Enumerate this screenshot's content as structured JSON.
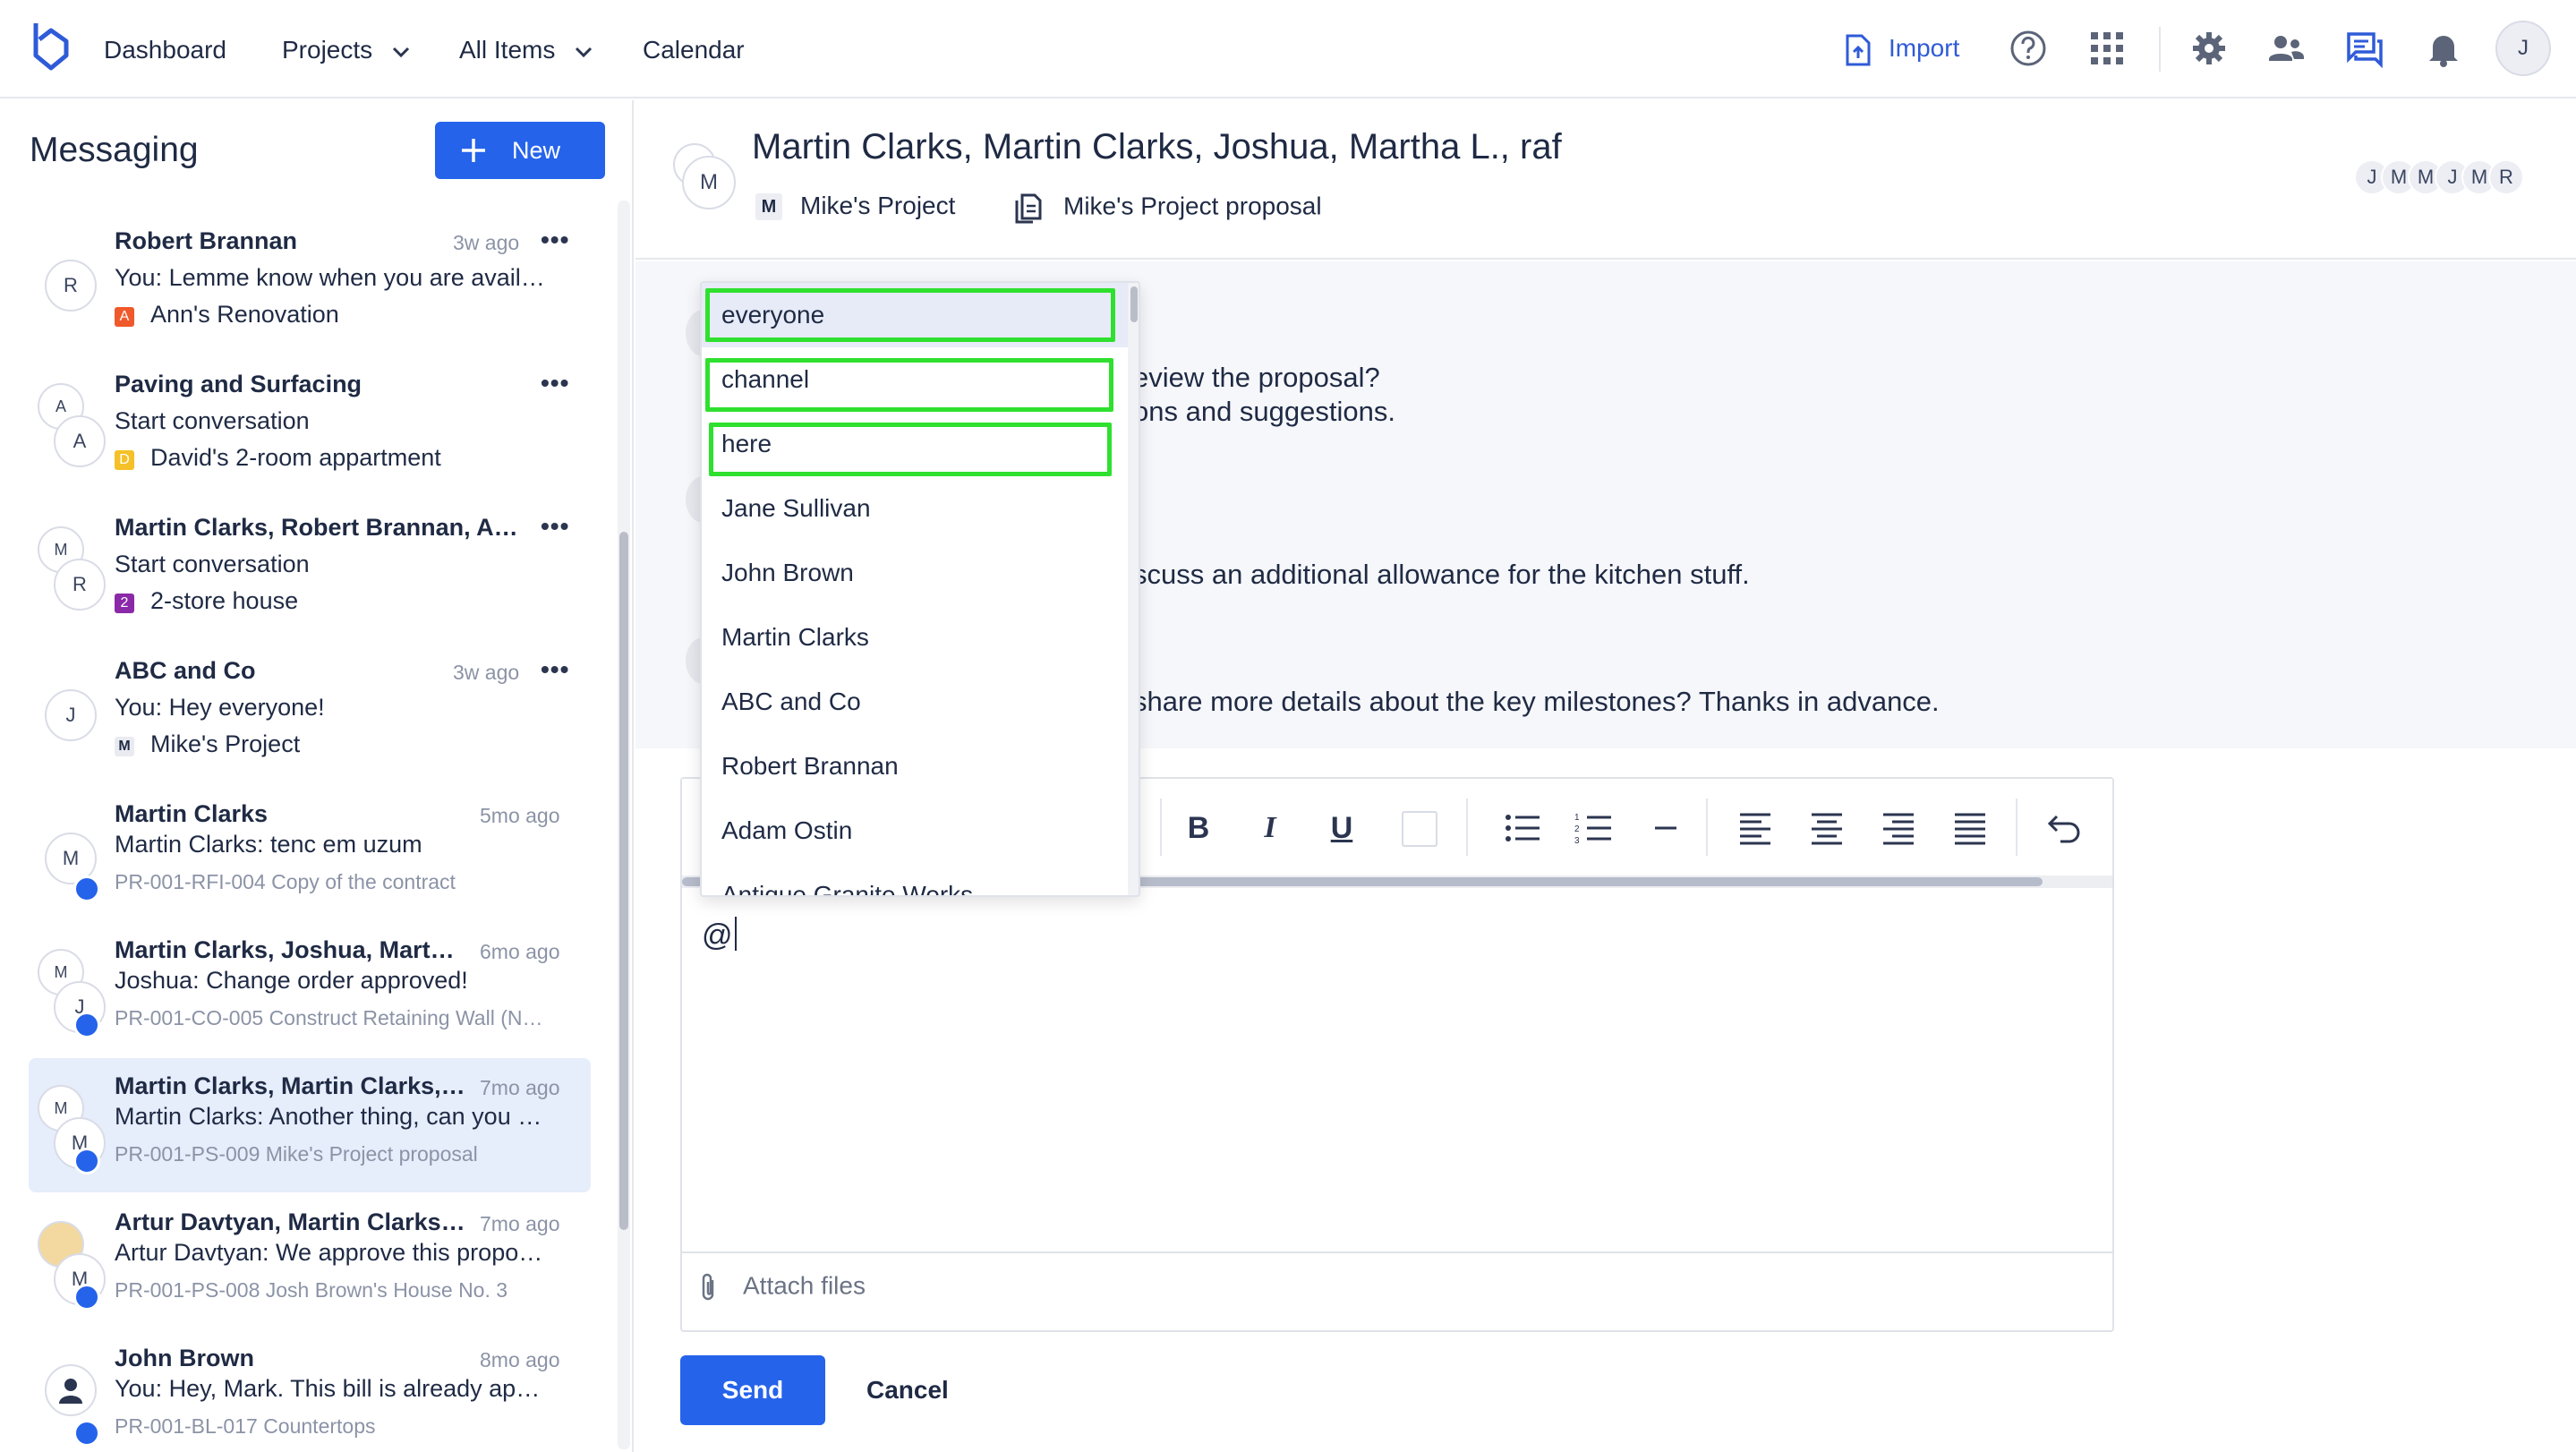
{
  "nav": {
    "items": [
      "Dashboard",
      "Projects",
      "All Items",
      "Calendar"
    ],
    "import_label": "Import",
    "user_initial": "J",
    "accent": "#2563eb"
  },
  "sidebar": {
    "title": "Messaging",
    "new_label": "New",
    "conversations": [
      {
        "avatar": "R",
        "name": "Robert Brannan",
        "time": "3w ago",
        "message": "You: Lemme know when you are avail…",
        "project": "Ann's Renovation",
        "badge": "A",
        "badge_color": "#f0592b"
      },
      {
        "avatar_back": "A",
        "avatar": "A",
        "name": "Paving and Surfacing",
        "time": "",
        "message": "Start conversation",
        "project": "David's 2-room appartment",
        "badge": "D",
        "badge_color": "#f5c028"
      },
      {
        "avatar_back": "M",
        "avatar": "R",
        "name": "Martin Clarks, Robert Brannan, Ad…",
        "time": "",
        "message": "Start conversation",
        "project": "2-store house",
        "badge": "2",
        "badge_color": "#8a2aa8"
      },
      {
        "avatar": "J",
        "name": "ABC and Co",
        "time": "3w ago",
        "message": "You: Hey everyone!",
        "project": "Mike's Project",
        "badge": "M",
        "badge_color": "#e9ebf1"
      },
      {
        "avatar": "M",
        "name": "Martin Clarks",
        "time": "5mo ago",
        "message": "Martin Clarks: tenc em uzum",
        "ref": "PR-001-RFI-004 Copy of the contract"
      },
      {
        "avatar_back": "M",
        "avatar": "J",
        "name": "Martin Clarks, Joshua, Marth…",
        "time": "6mo ago",
        "message": "Joshua: Change order approved!",
        "ref": "PR-001-CO-005 Construct Retaining Wall (N…"
      },
      {
        "avatar_back": "M",
        "avatar": "M",
        "name": "Martin Clarks, Martin Clarks, …",
        "time": "7mo ago",
        "message": "Martin Clarks: Another thing, can you …",
        "ref": "PR-001-PS-009 Mike's Project proposal"
      },
      {
        "avatar_back": "",
        "avatar": "M",
        "name": "Artur Davtyan, Martin Clarks, …",
        "time": "7mo ago",
        "message": "Artur Davtyan: We approve this propo…",
        "ref": "PR-001-PS-008 Josh Brown's House No. 3"
      },
      {
        "avatar": "",
        "name": "John Brown",
        "time": "8mo ago",
        "message": "You: Hey, Mark. This bill is already ap…",
        "ref": "PR-001-BL-017 Countertops"
      }
    ]
  },
  "thread": {
    "title": "Martin Clarks, Martin Clarks, Joshua, Martha L., raf",
    "project_badge": "M",
    "project": "Mike's Project",
    "item": "Mike's Project proposal",
    "avatar_initial": "M",
    "participants": [
      "J",
      "M",
      "M",
      "J",
      "M",
      "R"
    ],
    "messages": [
      "eview the proposal?",
      "ons and suggestions.",
      "scuss an additional allowance for the kitchen stuff.",
      "share more details about the key milestones? Thanks in advance."
    ]
  },
  "editor": {
    "text": "@",
    "attach_label": "Attach files",
    "send_label": "Send",
    "cancel_label": "Cancel",
    "toolbar": {
      "bold": "B",
      "italic": "I",
      "underline": "U"
    }
  },
  "mention": {
    "options": [
      "everyone",
      "channel",
      "here",
      "Jane Sullivan",
      "John Brown",
      "Martin Clarks",
      "ABC and Co",
      "Robert Brannan",
      "Adam Ostin",
      "Antique Granite Works"
    ],
    "highlight_color": "#2fe02f"
  }
}
